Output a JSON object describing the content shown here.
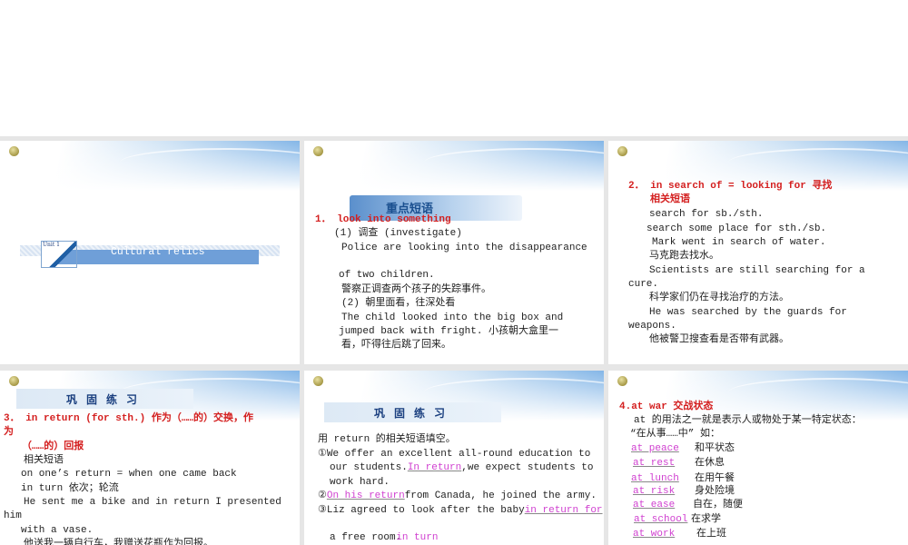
{
  "slide1": {
    "unit_label": "Unit 1",
    "title": "Cultural  relics"
  },
  "slide2": {
    "banner": "重点短语",
    "lines": [
      "1． look into something",
      "(1) 调查  (investigate)",
      "Police are looking into the disappearance",
      "of two children.",
      "警察正调查两个孩子的失踪事件。",
      "(2)  朝里面看，往深处看",
      "The child looked into the big box and",
      "jumped back with fright.  小孩朝大盒里一",
      "看，吓得往后跳了回来。"
    ]
  },
  "slide3": {
    "lines": [
      "2． in search of = looking for   寻找",
      "相关短语",
      "search for sb./sth.",
      "search some place for sth./sb.",
      "Mark went in search of water.",
      "马克跑去找水。",
      "Scientists are still searching for a",
      "cure.",
      "科学家们仍在寻找治疗的方法。",
      "He was searched by the guards for",
      "weapons.",
      "他被警卫搜查看是否带有武器。"
    ]
  },
  "slide4": {
    "banner": "巩固练习",
    "lines": [
      "3． in return (for sth.)    作为（……的）交换，作",
      "为",
      "（……的）回报",
      "相关短语",
      "on one’s return = when one came back",
      "in turn  依次；轮流",
      "He sent me a bike and in return I presented",
      "him",
      "with a vase.",
      "他送我一辆自行车，我赠送花瓶作为回报。"
    ]
  },
  "slide5": {
    "banner": "巩固练习",
    "intro": "用 return 的相关短语填空。",
    "q1a": "①We offer an excellent all-round education to",
    "q1b": "our students.",
    "a1": "In return",
    "q1c": ",we expect students to",
    "q1d": "work hard.",
    "q2n": "②",
    "a2": "On his return",
    "q2": "from Canada, he joined the army.",
    "q3": "③Liz agreed to look after the baby",
    "a3": "in return for",
    "q3b": "a free room.",
    "a4": "in turn"
  },
  "slide6": {
    "title": "4.at war   交战状态",
    "intro1": "at  的用法之一就是表示人或物处于某一特定状态：",
    "intro2": "“在从事……中”   如：",
    "items": [
      {
        "en": "at peace",
        "zh": "和平状态"
      },
      {
        "en": "at rest",
        "zh": "在休息"
      },
      {
        "en": "at lunch",
        "zh": "在用午餐"
      },
      {
        "en": "at risk",
        "zh": "身处险境"
      },
      {
        "en": "at ease",
        "zh": "自在，随便"
      },
      {
        "en": "at school",
        "zh": "在求学"
      },
      {
        "en": "at work",
        "zh": "在上班"
      }
    ]
  }
}
